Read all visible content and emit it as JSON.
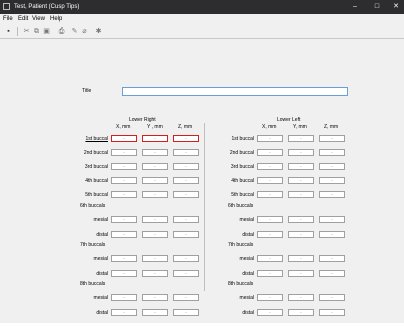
{
  "window": {
    "title": "Test, Patient (Cusp Tips)",
    "controls": {
      "minimize": "–",
      "maximize": "□",
      "close": "✕"
    }
  },
  "menu": [
    "File",
    "Edit",
    "View",
    "Help"
  ],
  "toolbar": {
    "icons": [
      "save-icon",
      "cut-icon",
      "copy-icon",
      "paste-icon",
      "print-icon",
      "draw-icon",
      "erase-icon",
      "tools-icon"
    ]
  },
  "form": {
    "title_label": "Title",
    "title_value": "",
    "field_placeholder": ".",
    "lower_right": {
      "heading": "Lower Right",
      "columns": [
        "X, mm",
        "Y , mm",
        "Z, mm"
      ],
      "rows": [
        "1st buccal",
        "2nd buccal",
        "3rd buccal",
        "4th buccal",
        "5th buccal"
      ],
      "molars": [
        {
          "heading": "6th buccals",
          "rows": [
            "mesial",
            "distal"
          ]
        },
        {
          "heading": "7th buccals",
          "rows": [
            "mesial",
            "distal"
          ]
        },
        {
          "heading": "8th buccals",
          "rows": [
            "mesial",
            "distal"
          ]
        }
      ]
    },
    "lower_left": {
      "heading": "Lower Left",
      "columns": [
        "X, mm",
        "Y, mm",
        "Z, mm"
      ],
      "rows": [
        "1st buccal",
        "2nd buccal",
        "3rd buccal",
        "4th buccal",
        "5th buccal"
      ],
      "molars": [
        {
          "heading": "6th buccals",
          "rows": [
            "mesial",
            "distal"
          ]
        },
        {
          "heading": "7th buccals",
          "rows": [
            "mesial",
            "distal"
          ]
        },
        {
          "heading": "8th buccals",
          "rows": [
            "mesial",
            "distal"
          ]
        }
      ]
    }
  }
}
